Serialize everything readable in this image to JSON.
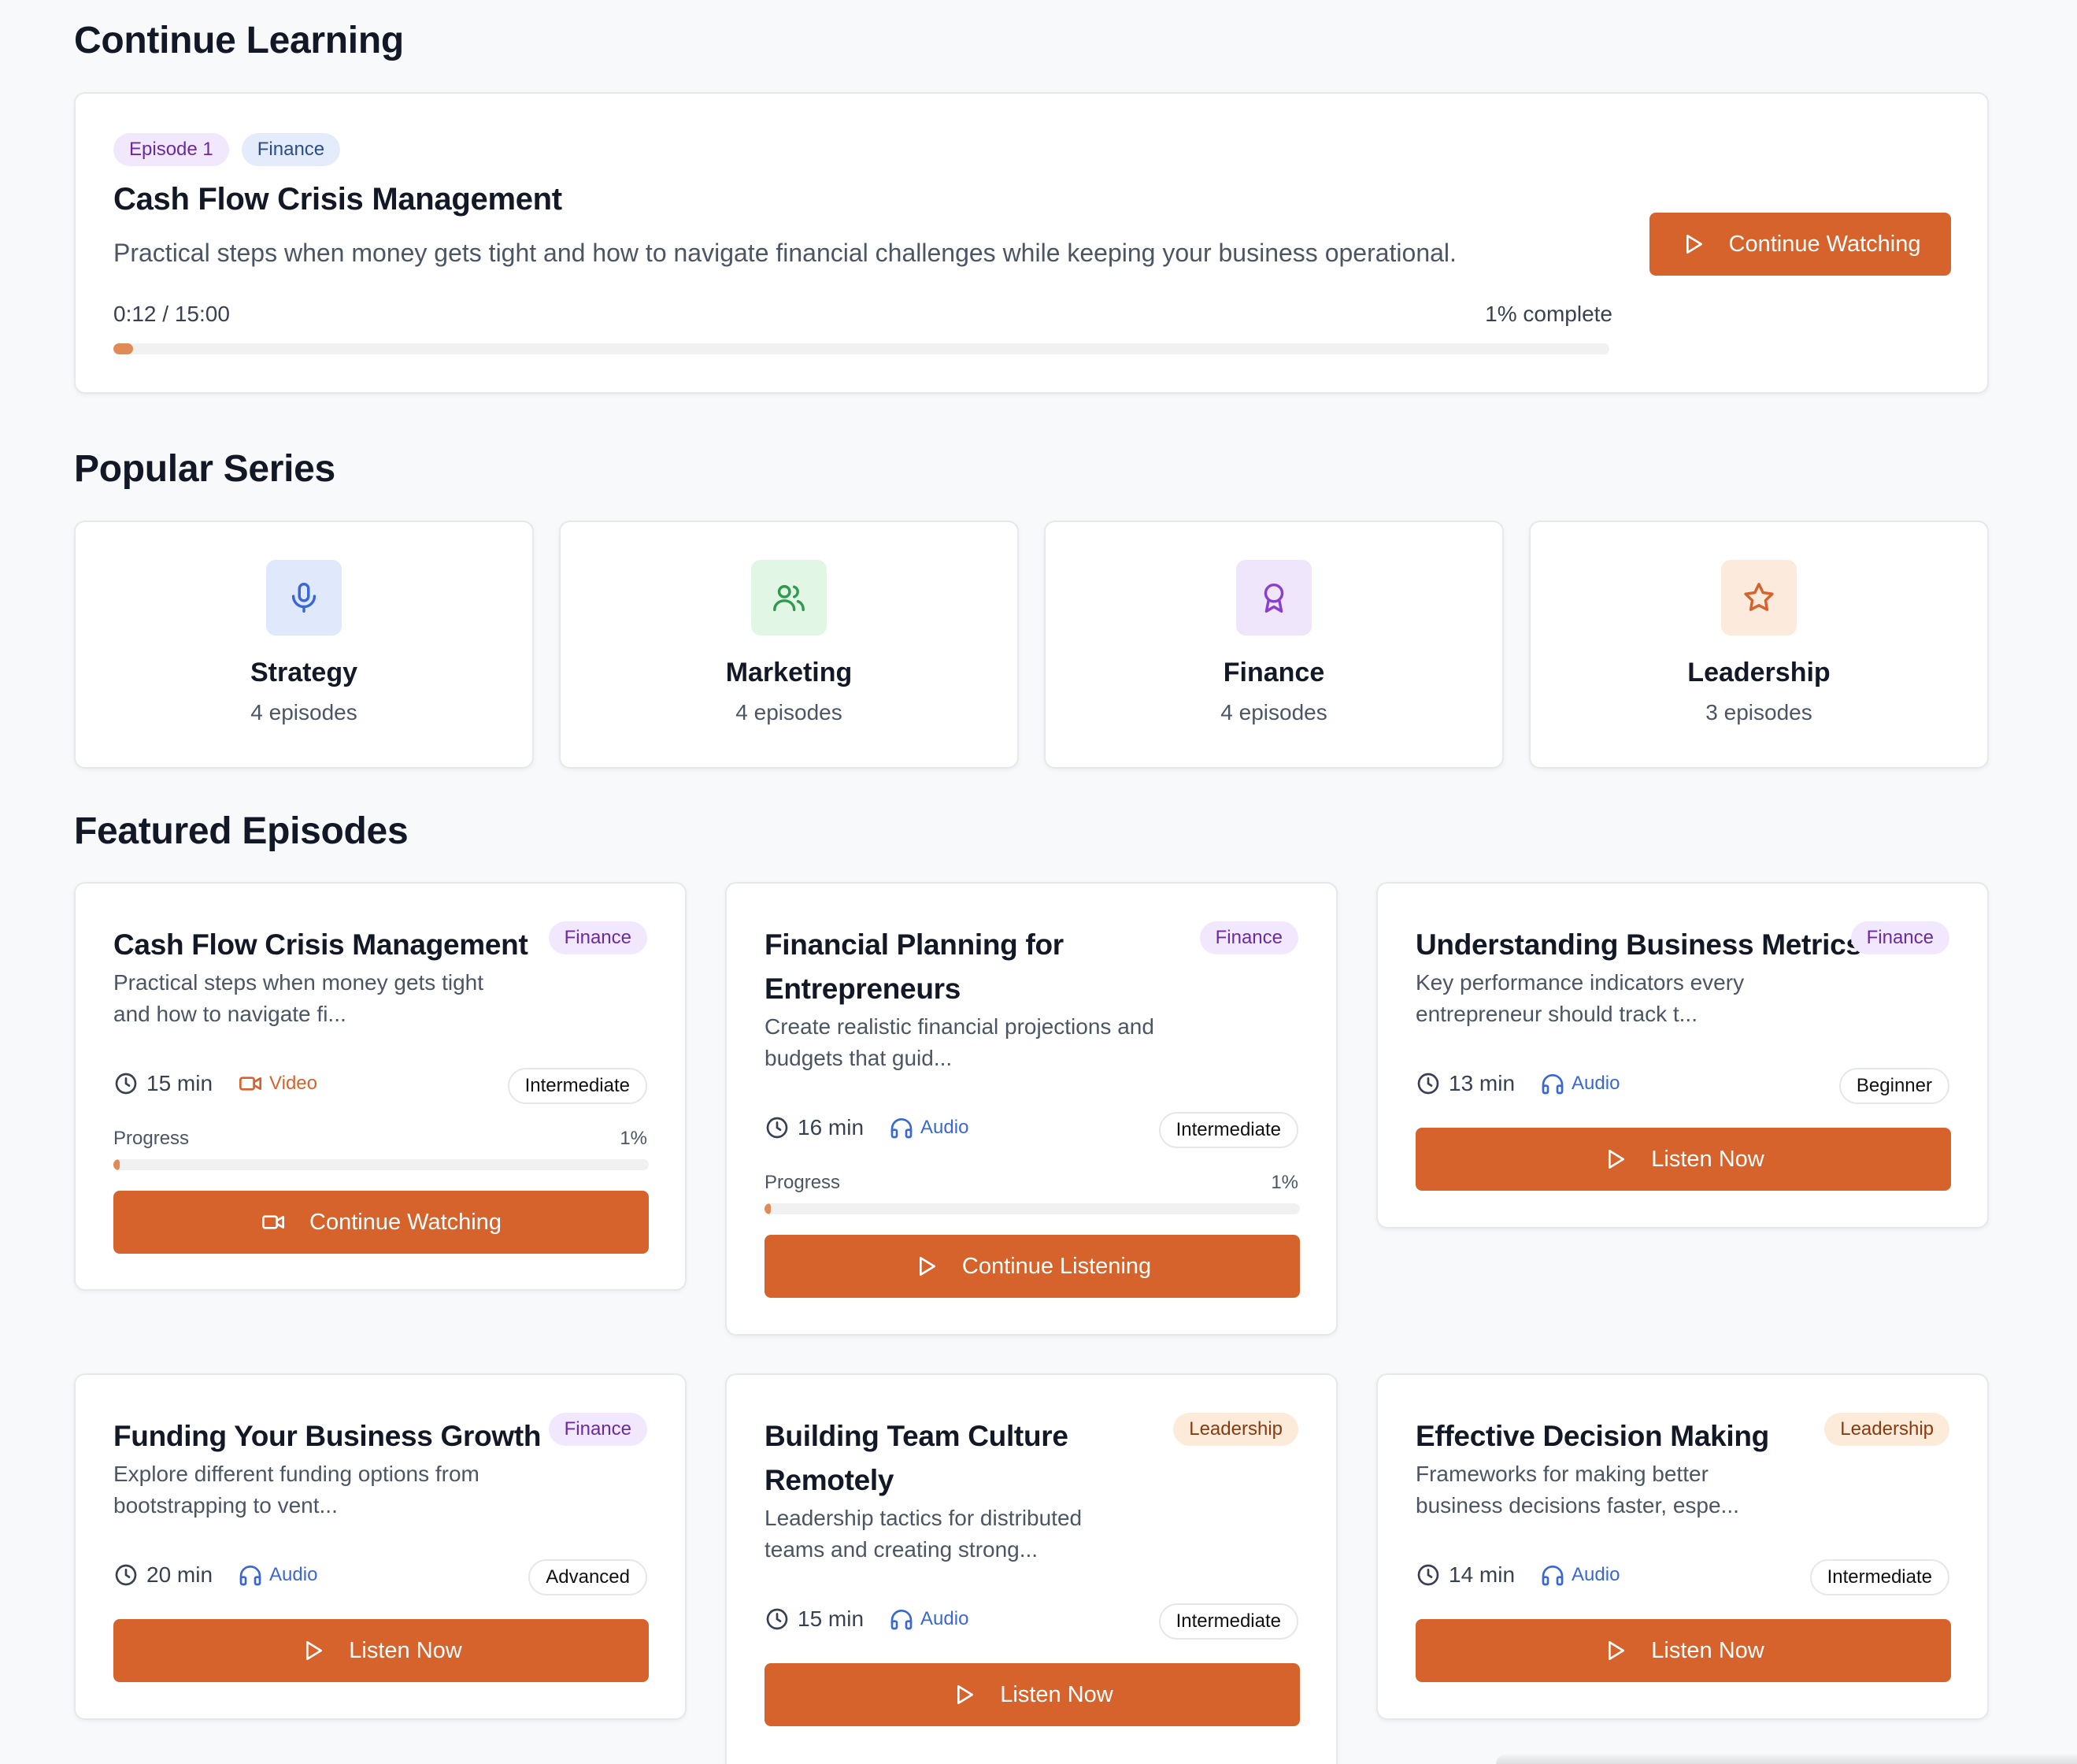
{
  "continue_learning": {
    "heading": "Continue Learning",
    "episode_tag": "Episode 1",
    "category_tag": "Finance",
    "title": "Cash Flow Crisis Management",
    "description": "Practical steps when money gets tight and how to navigate financial challenges while keeping your business operational.",
    "time": "0:12 / 15:00",
    "complete_label": "1% complete",
    "progress": 0.013,
    "button_label": "Continue Watching"
  },
  "popular_series": {
    "heading": "Popular Series",
    "items": [
      {
        "name": "Strategy",
        "count": "4 episodes",
        "icon": "microphone-icon"
      },
      {
        "name": "Marketing",
        "count": "4 episodes",
        "icon": "users-icon"
      },
      {
        "name": "Finance",
        "count": "4 episodes",
        "icon": "award-icon"
      },
      {
        "name": "Leadership",
        "count": "3 episodes",
        "icon": "star-icon"
      }
    ]
  },
  "featured": {
    "heading": "Featured Episodes",
    "progress_label": "Progress",
    "episodes": [
      {
        "title": "Cash Flow Crisis Management",
        "category": "Finance",
        "description_lines": [
          "Practical steps when money gets tight",
          "and how to navigate fi..."
        ],
        "duration": "15 min",
        "media": "Video",
        "level": "Intermediate",
        "progress_pct": "1%",
        "progress": 0.01,
        "button": "Continue Watching"
      },
      {
        "title_lines": [
          "Financial Planning for",
          "Entrepreneurs"
        ],
        "category": "Finance",
        "description_lines": [
          "Create realistic financial projections and",
          "budgets that guid..."
        ],
        "duration": "16 min",
        "media": "Audio",
        "level": "Intermediate",
        "progress_pct": "1%",
        "progress": 0.01,
        "button": "Continue Listening"
      },
      {
        "title": "Understanding Business Metrics",
        "category": "Finance",
        "description_lines": [
          "Key performance indicators every",
          "entrepreneur should track t..."
        ],
        "duration": "13 min",
        "media": "Audio",
        "level": "Beginner",
        "button": "Listen Now"
      },
      {
        "title": "Funding Your Business Growth",
        "category": "Finance",
        "description_lines": [
          "Explore different funding options from",
          "bootstrapping to vent..."
        ],
        "duration": "20 min",
        "media": "Audio",
        "level": "Advanced",
        "button": "Listen Now"
      },
      {
        "title_lines": [
          "Building Team Culture",
          "Remotely"
        ],
        "category": "Leadership",
        "description_lines": [
          "Leadership tactics for distributed",
          "teams and creating strong..."
        ],
        "duration": "15 min",
        "media": "Audio",
        "level": "Intermediate",
        "button": "Listen Now"
      },
      {
        "title": "Effective Decision Making",
        "category": "Leadership",
        "description_lines": [
          "Frameworks for making better",
          "business decisions faster, espe..."
        ],
        "duration": "14 min",
        "media": "Audio",
        "level": "Intermediate",
        "button": "Listen Now"
      }
    ]
  },
  "colors": {
    "accent": "#d6622c",
    "finance_pill_bg": "#f1e8fd",
    "leadership_pill_bg": "#fdebd9",
    "audio_blue": "#3a67d6",
    "video_orange": "#d6622c"
  }
}
